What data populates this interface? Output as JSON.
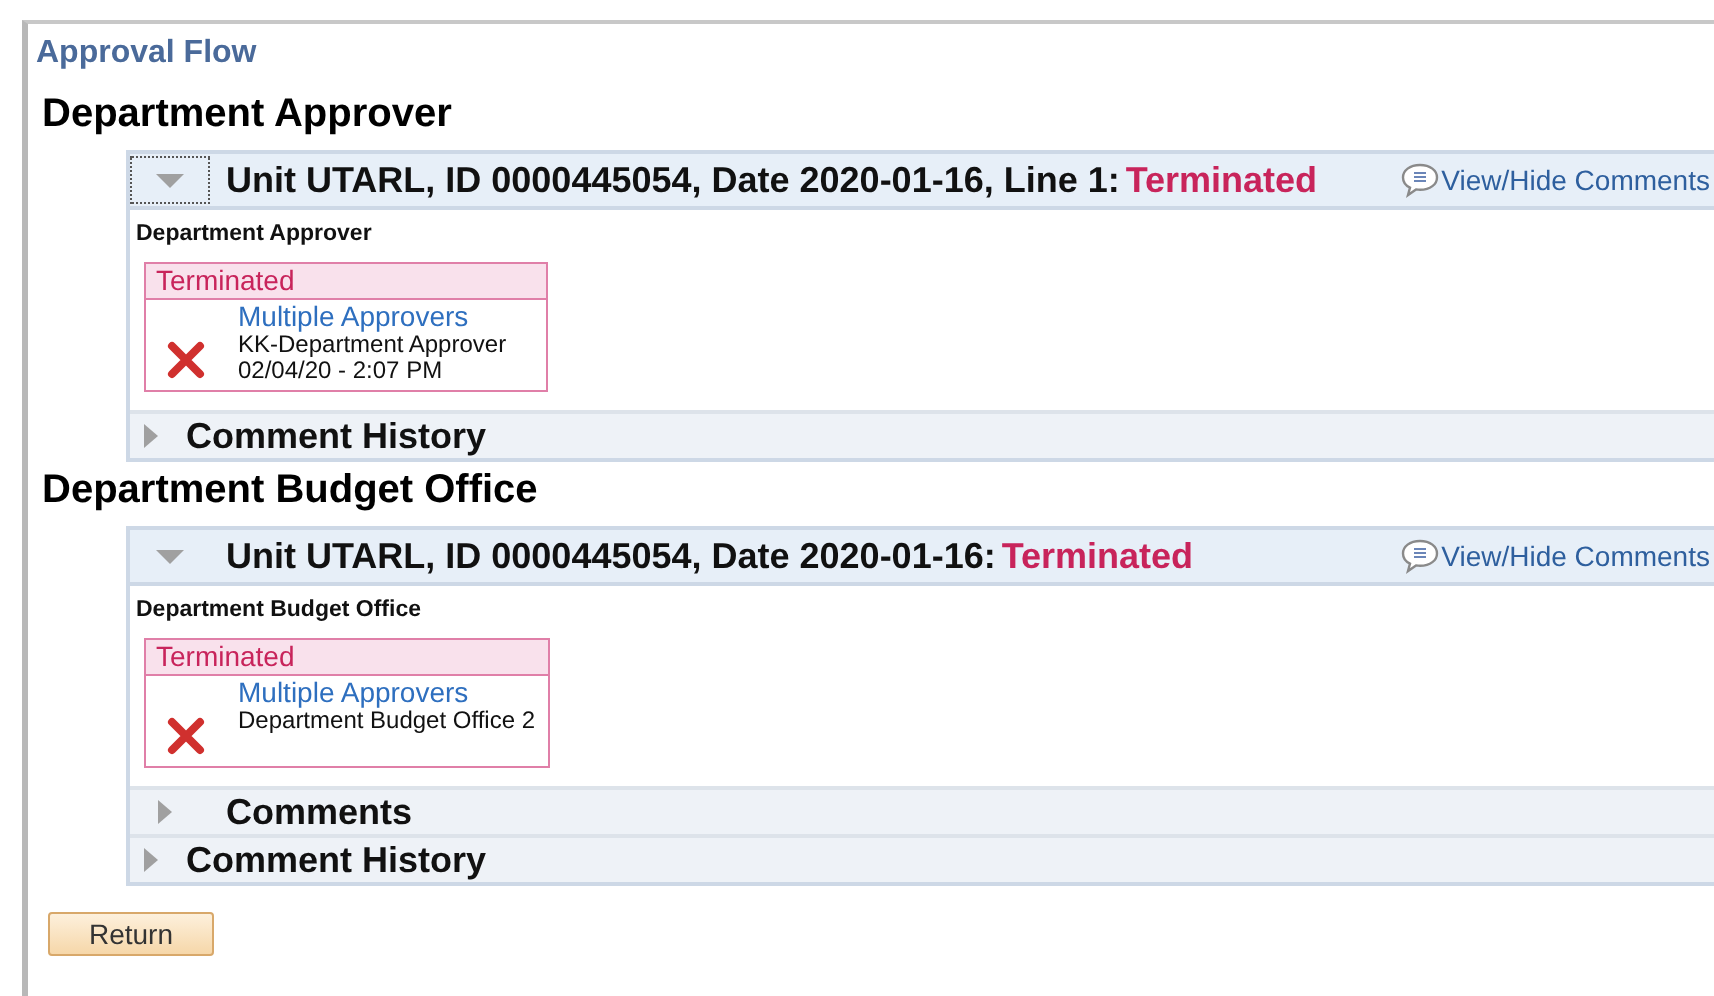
{
  "page_title": "Approval Flow",
  "sections": [
    {
      "heading": "Department Approver",
      "panel": {
        "expanded": true,
        "focused": true,
        "title": "Unit UTARL, ID 0000445054, Date 2020-01-16, Line 1:",
        "status": "Terminated",
        "link": "View/Hide Comments",
        "step": "Department Approver",
        "card": {
          "status": "Terminated",
          "approver": "Multiple Approvers",
          "lines": [
            "KK-Department Approver",
            "02/04/20 - 2:07 PM"
          ]
        },
        "subsections": [
          {
            "label": "Comment History",
            "expanded": false,
            "indent": false
          }
        ]
      }
    },
    {
      "heading": "Department Budget Office",
      "panel": {
        "expanded": true,
        "focused": false,
        "title": "Unit UTARL, ID 0000445054, Date 2020-01-16:",
        "status": "Terminated",
        "link": "View/Hide Comments",
        "step": "Department Budget Office",
        "card": {
          "status": "Terminated",
          "approver": "Multiple Approvers",
          "lines": [
            "Department Budget Office 2"
          ]
        },
        "subsections": [
          {
            "label": "Comments",
            "expanded": false,
            "indent": true
          },
          {
            "label": "Comment History",
            "expanded": false,
            "indent": false
          }
        ]
      }
    }
  ],
  "buttons": [
    "Return"
  ]
}
